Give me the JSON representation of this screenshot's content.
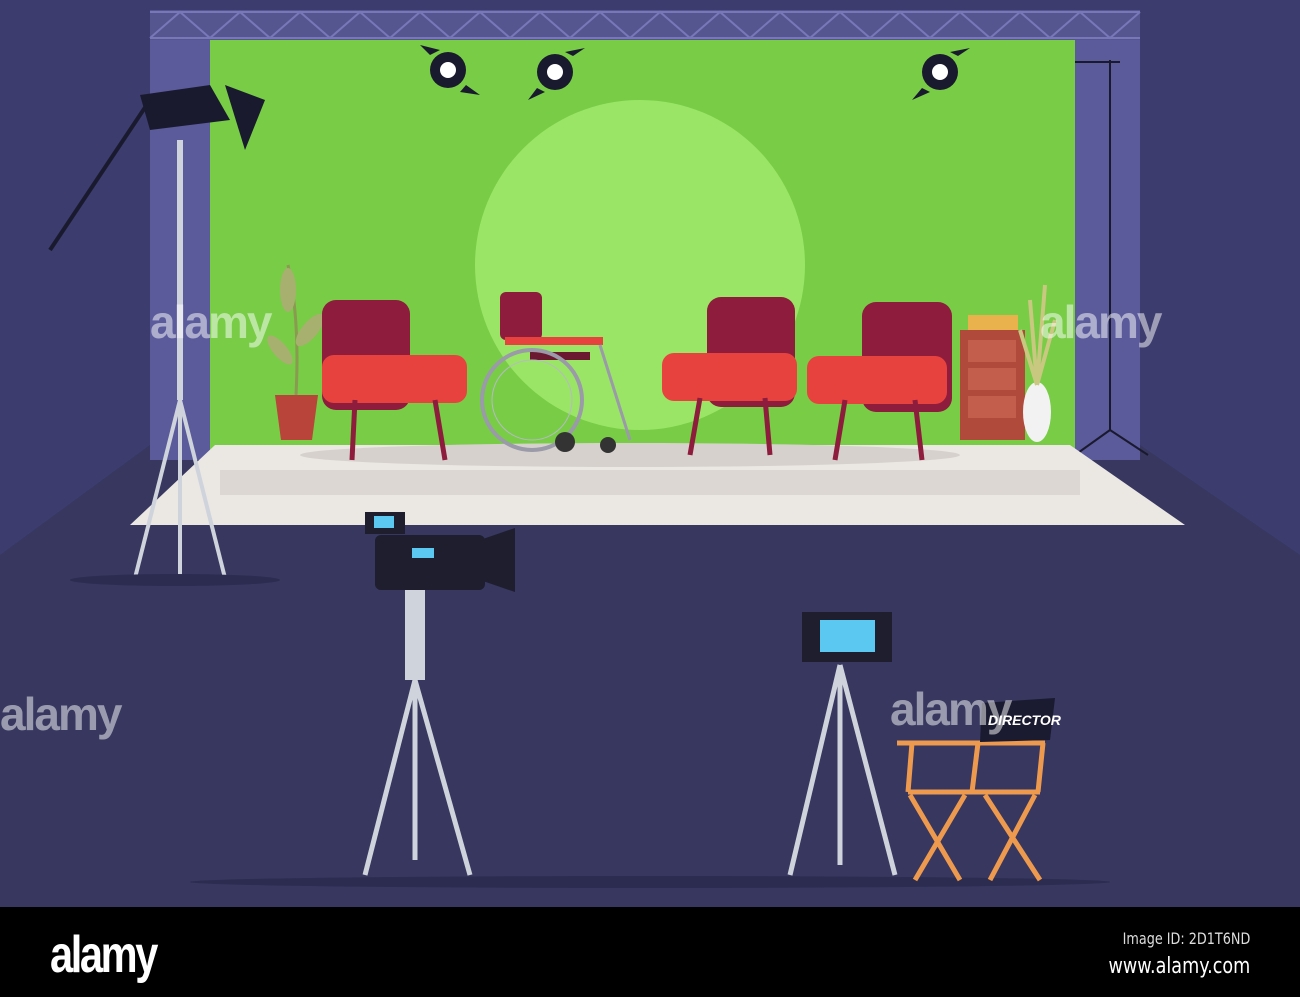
{
  "scene": {
    "chair_label": "DIRECTOR",
    "watermark": "alamy"
  },
  "footer": {
    "logo": "alamy",
    "image_id": "Image ID: 2D1T6ND",
    "url": "www.alamy.com"
  },
  "colors": {
    "background": "#383863",
    "green_screen": "#78cc46",
    "spotlight": "#9ae565",
    "truss": "#5b5b9c",
    "stage": "#ebe7e3",
    "armchair": "#e8423f",
    "armchair_back": "#8e1c3c",
    "director_chair": "#ee9a4e"
  }
}
